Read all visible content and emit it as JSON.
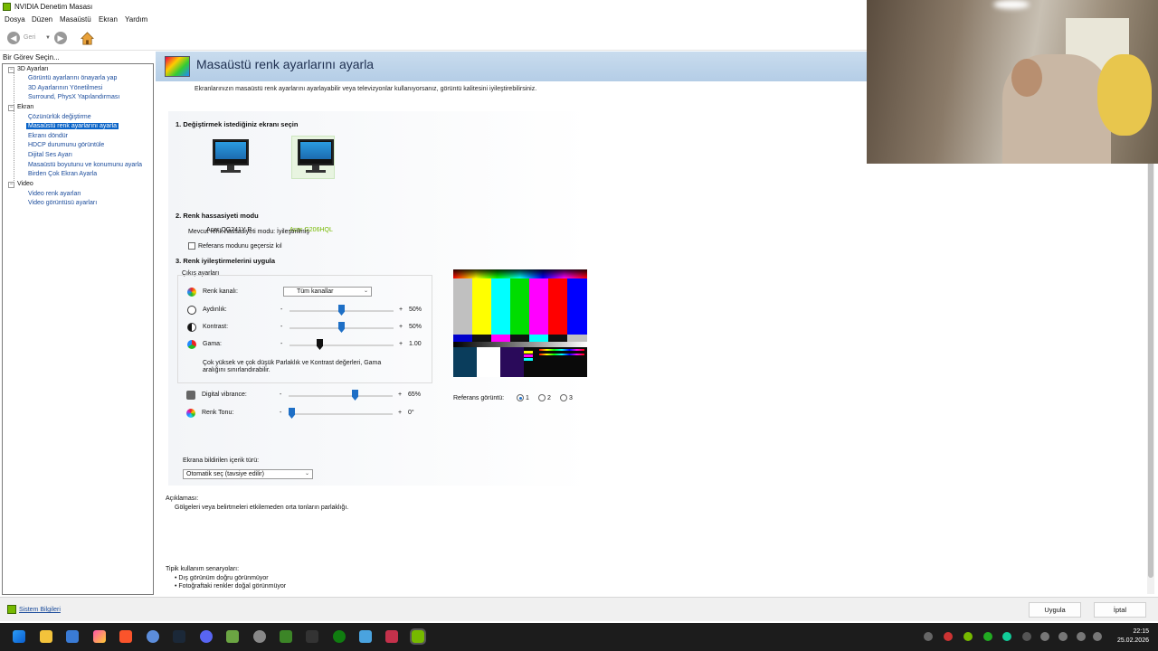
{
  "window": {
    "title": "NVIDIA Denetim Masası"
  },
  "menu": [
    "Dosya",
    "Düzen",
    "Masaüstü",
    "Ekran",
    "Yardım"
  ],
  "toolbar": {
    "back_label": "Geri"
  },
  "tree": {
    "header": "Bir Görev Seçin...",
    "categories": [
      {
        "label": "3D Ayarları",
        "toggle": "−",
        "items": [
          "Görüntü ayarlarını önayarla yap",
          "3D Ayarlarının Yönetilmesi",
          "Surround, PhysX Yapılandırması"
        ]
      },
      {
        "label": "Ekran",
        "toggle": "−",
        "items": [
          "Çözünürlük değiştirme",
          "Masaüstü renk ayarlarını ayarla",
          "Ekranı döndür",
          "HDCP durumunu görüntüle",
          "Dijital Ses Ayarı",
          "Masaüstü boyutunu ve konumunu ayarla",
          "Birden Çok Ekran Ayarla"
        ]
      },
      {
        "label": "Video",
        "toggle": "−",
        "items": [
          "Video renk ayarları",
          "Video görüntüsü ayarları"
        ]
      }
    ],
    "selected": "Masaüstü renk ayarlarını ayarla"
  },
  "page": {
    "title": "Masaüstü renk ayarlarını ayarla",
    "intro": "Ekranlarınızın masaüstü renk ayarlarını ayarlayabilir veya televizyonlar kullanıyorsanız, görüntü kalitesini iyileştirebilirsiniz.",
    "section1": {
      "title": "1. Değiştirmek istediğiniz ekranı seçin",
      "monitors": [
        {
          "name": "Acer QG241Y P",
          "selected": false
        },
        {
          "name": "Acer G206HQL",
          "selected": true
        }
      ]
    },
    "section2": {
      "title": "2. Renk hassasiyeti modu",
      "current_mode": "Mevcut renk hassasiyeti modu: İyileştirilmiş",
      "override_label": "Referans modunu geçersiz kıl",
      "override_checked": false
    },
    "section3": {
      "title": "3. Renk iyileştirmelerini uygula",
      "group_label": "Çıkış ayarları",
      "channel_label": "Renk kanalı:",
      "channel_value": "Tüm kanallar",
      "brightness": {
        "label": "Aydınlık:",
        "minus": "-",
        "plus": "+",
        "value": "50%",
        "level": 0.5
      },
      "contrast": {
        "label": "Kontrast:",
        "minus": "-",
        "plus": "+",
        "value": "50%",
        "level": 0.5
      },
      "gamma": {
        "label": "Gama:",
        "minus": "-",
        "plus": "+",
        "value": "1.00",
        "level": 0.29
      },
      "warning": "Çok yüksek ve çok düşük Parlaklık ve Kontrast değerleri, Gama aralığını sınırlandırabilir.",
      "vibrance": {
        "label": "Digital vibrance:",
        "minus": "-",
        "plus": "+",
        "value": "65%",
        "level": 0.65
      },
      "hue": {
        "label": "Renk Tonu:",
        "minus": "-",
        "plus": "+",
        "value": "0°",
        "level": 0.0
      },
      "content_type_label": "Ekrana bildirilen içerik türü:",
      "content_type_value": "Otomatik seç (tavsiye edilir)"
    },
    "reference": {
      "label": "Referans görüntü:",
      "options": [
        "1",
        "2",
        "3"
      ],
      "selected": "1"
    },
    "description": {
      "label": "Açıklaması:",
      "text": "Gölgeleri veya belirtmeleri etkilemeden orta tonların parlaklığı."
    },
    "scenarios": {
      "label": "Tipik kullanım senaryoları:",
      "items": [
        "• Dış görünüm doğru görünmüyor",
        "• Fotoğraftaki renkler doğal görünmüyor"
      ]
    }
  },
  "footer": {
    "system_info": "Sistem Bilgileri",
    "apply": "Uygula",
    "cancel": "İptal"
  },
  "taskbar": {
    "time": "22:15",
    "date": "25.02.2026"
  }
}
